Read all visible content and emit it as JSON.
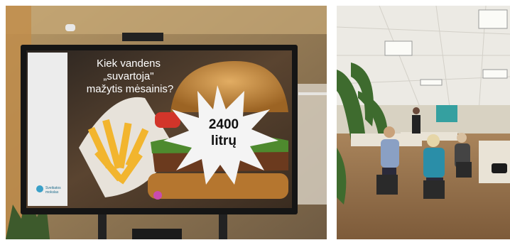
{
  "left_photo": {
    "slide": {
      "question_line1": "Kiek vandens",
      "question_line2": "„suvartoja\"",
      "question_line3": "mažytis mėsainis?",
      "burst_value": "2400",
      "burst_unit": "litrų",
      "logo_line1": "Sveikatos",
      "logo_line2": "mokslas"
    },
    "colors": {
      "screen_frame": "#1a1a1a",
      "slide_bg": "#3c2f22",
      "burst": "#f4f4f4"
    }
  },
  "right_photo": {
    "colors": {
      "floor": "#8b6a48",
      "ceiling": "#eceae4"
    }
  }
}
